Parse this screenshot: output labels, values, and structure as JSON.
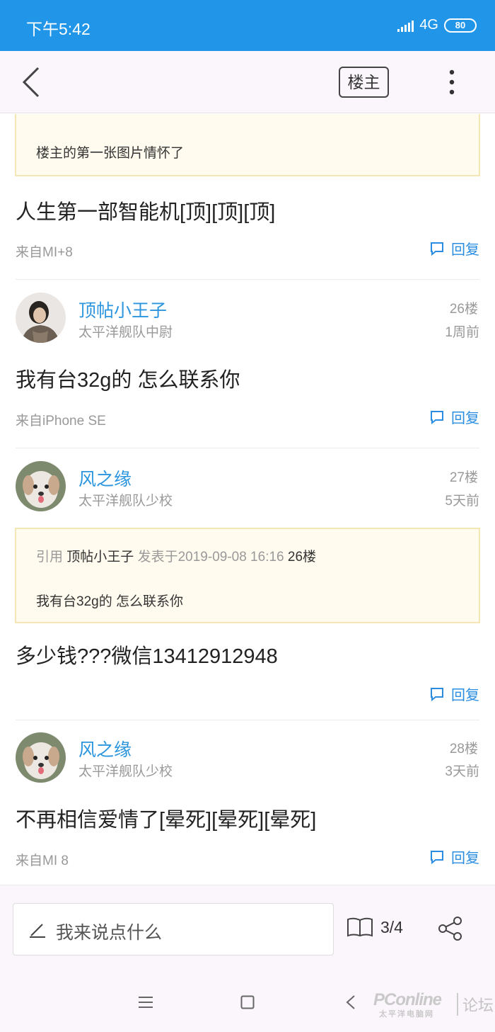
{
  "status_bar": {
    "time": "下午5:42",
    "network": "4G",
    "battery": "80"
  },
  "header": {
    "louzhu_label": "楼主"
  },
  "top_quote": {
    "text": "楼主的第一张图片情怀了"
  },
  "posts": [
    {
      "text": "人生第一部智能机[顶][顶][顶]",
      "from": "来自MI+8",
      "reply_label": "回复"
    },
    {
      "username": "顶帖小王子",
      "user_title": "太平洋舰队中尉",
      "floor": "26楼",
      "time": "1周前",
      "text": "我有台32g的 怎么联系你",
      "from": "来自iPhone SE",
      "reply_label": "回复"
    },
    {
      "username": "风之缘",
      "user_title": "太平洋舰队少校",
      "floor": "27楼",
      "time": "5天前",
      "quote": {
        "prefix": "引用",
        "user": "顶帖小王子",
        "posted": "发表于2019-09-08 16:16",
        "floor": "26楼",
        "text": "我有台32g的 怎么联系你"
      },
      "text": "多少钱???微信13412912948",
      "reply_label": "回复"
    },
    {
      "username": "风之缘",
      "user_title": "太平洋舰队少校",
      "floor": "28楼",
      "time": "3天前",
      "text": "不再相信爱情了[晕死][晕死][晕死]",
      "from": "来自MI 8",
      "reply_label": "回复"
    }
  ],
  "bottom_bar": {
    "input_placeholder": "我来说点什么",
    "page_indicator": "3/4"
  },
  "watermark": {
    "brand": "PConline",
    "brand_sub": "太平洋电脑网",
    "forum": "论坛"
  },
  "colors": {
    "status_bar": "#2196e8",
    "accent": "#2b95de",
    "quote_border": "#f5e6b6"
  },
  "icons": [
    "back-icon",
    "more-icon",
    "reply-icon",
    "pen-icon",
    "book-icon",
    "share-icon",
    "menu-icon",
    "home-icon",
    "nav-back-icon"
  ]
}
